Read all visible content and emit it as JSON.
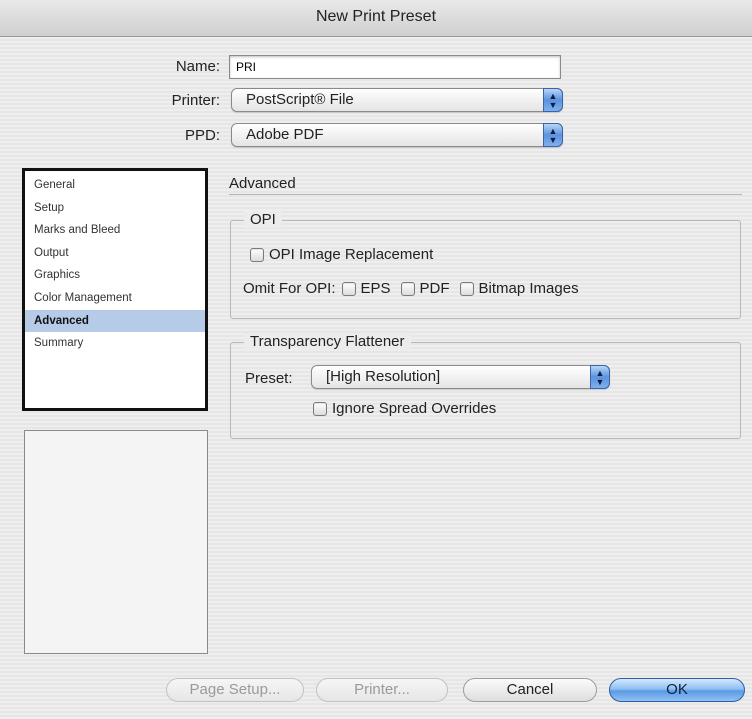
{
  "dialog": {
    "title": "New Print Preset"
  },
  "fields": {
    "name_label": "Name:",
    "name_value": "PRI",
    "printer_label": "Printer:",
    "printer_value": "PostScript® File",
    "ppd_label": "PPD:",
    "ppd_value": "Adobe PDF"
  },
  "sidebar": {
    "items": [
      {
        "label": "General",
        "selected": false
      },
      {
        "label": "Setup",
        "selected": false
      },
      {
        "label": "Marks and Bleed",
        "selected": false
      },
      {
        "label": "Output",
        "selected": false
      },
      {
        "label": "Graphics",
        "selected": false
      },
      {
        "label": "Color Management",
        "selected": false
      },
      {
        "label": "Advanced",
        "selected": true
      },
      {
        "label": "Summary",
        "selected": false
      }
    ]
  },
  "advanced": {
    "section_title": "Advanced",
    "opi": {
      "legend": "OPI",
      "image_replacement_label": "OPI Image Replacement",
      "image_replacement_checked": false,
      "omit_label": "Omit For OPI:",
      "omit_options": [
        {
          "label": "EPS",
          "checked": false
        },
        {
          "label": "PDF",
          "checked": false
        },
        {
          "label": "Bitmap Images",
          "checked": false
        }
      ]
    },
    "flattener": {
      "legend": "Transparency Flattener",
      "preset_label": "Preset:",
      "preset_value": "[High Resolution]",
      "ignore_overrides_label": "Ignore Spread Overrides",
      "ignore_overrides_checked": false
    }
  },
  "buttons": {
    "page_setup": "Page Setup...",
    "printer": "Printer...",
    "cancel": "Cancel",
    "ok": "OK"
  }
}
